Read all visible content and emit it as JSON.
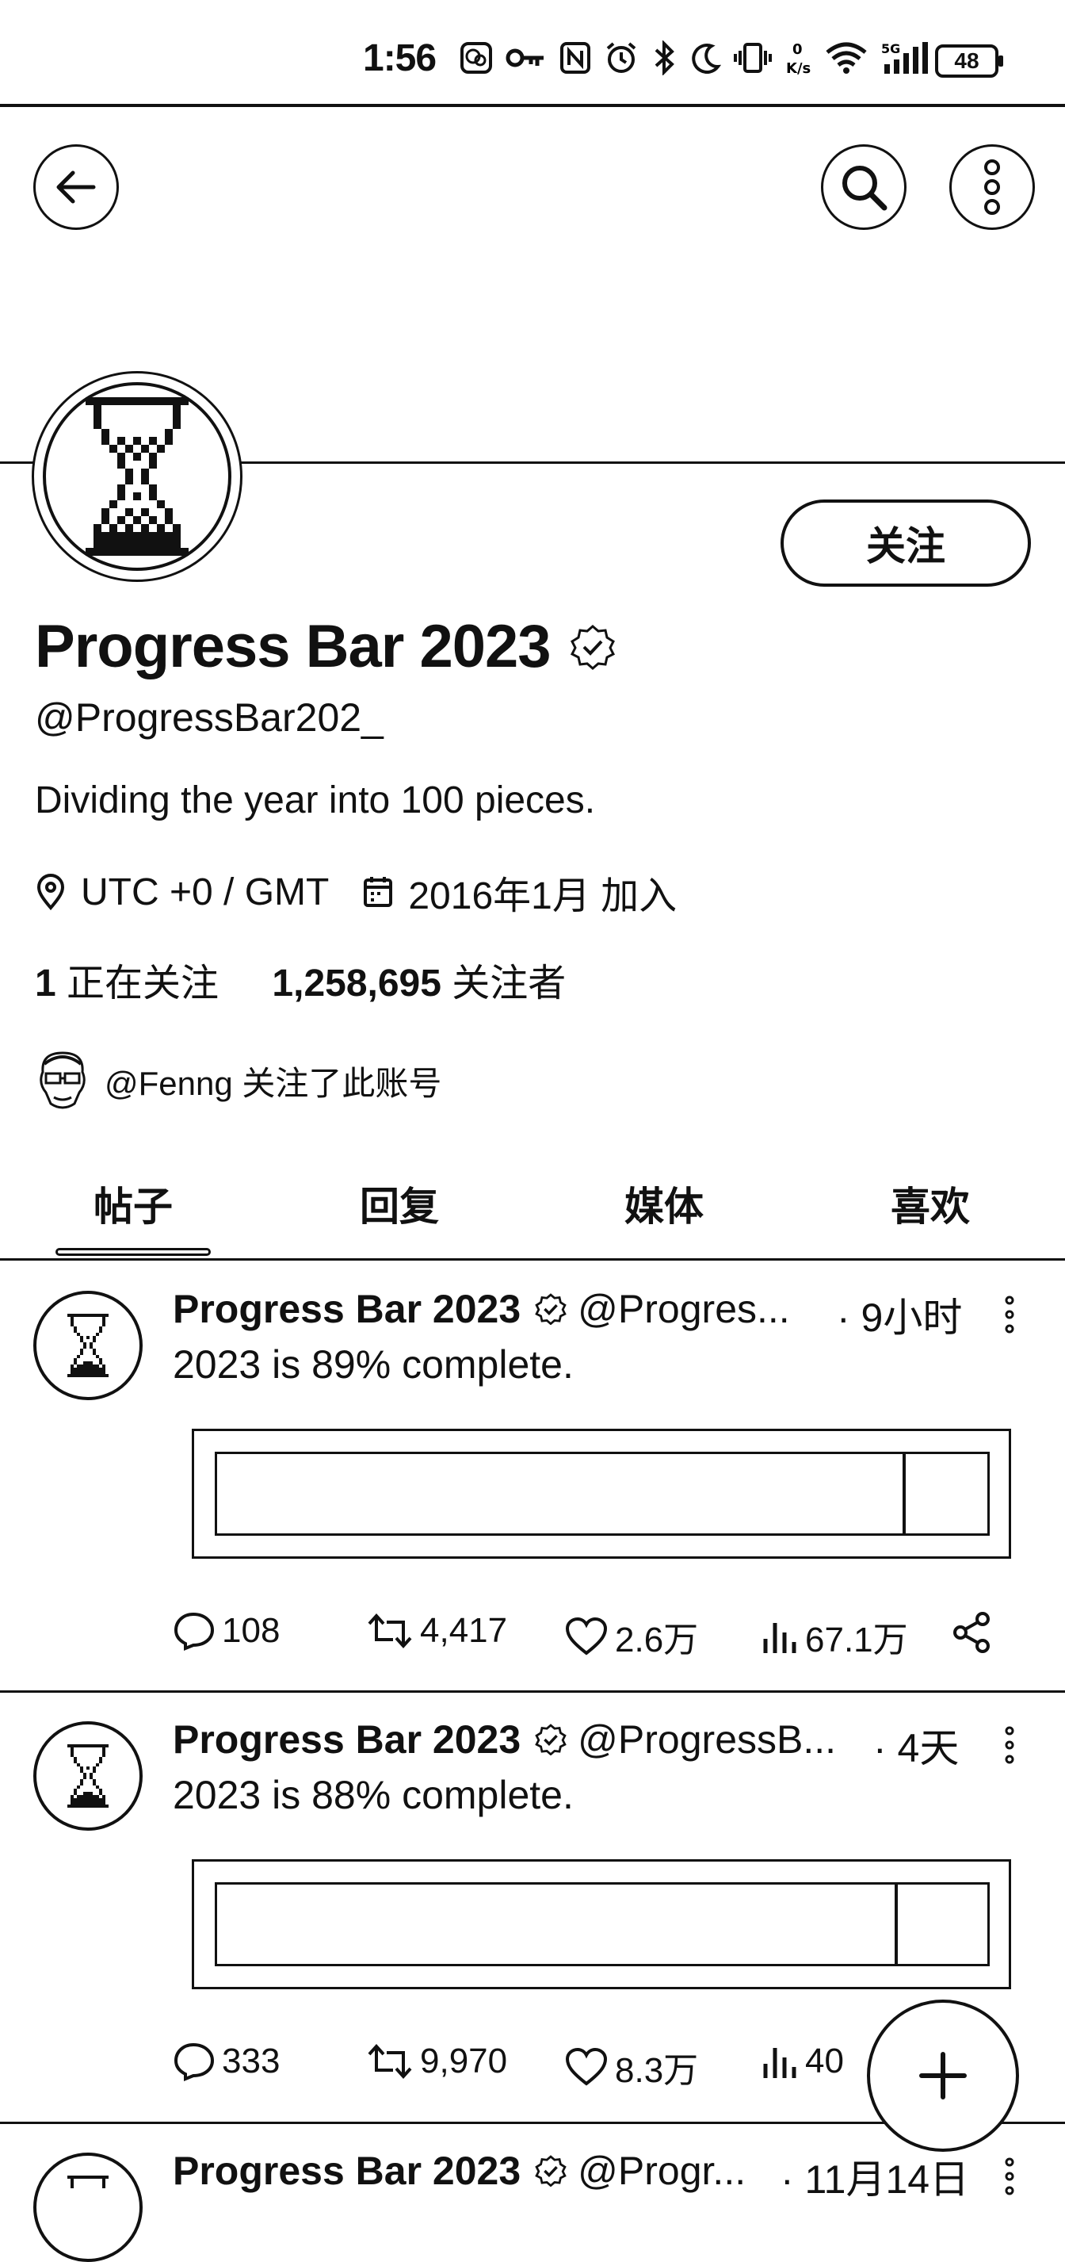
{
  "status_bar": {
    "time": "1:56",
    "battery": "48",
    "icons": [
      "wechat-icon",
      "key-icon",
      "nfc-icon",
      "alarm-icon",
      "bluetooth-icon",
      "moon-icon",
      "vibrate-icon",
      "data-speed-icon",
      "wifi-icon",
      "signal-5g-icon"
    ],
    "data_speed": "0 K/s",
    "network": "5G"
  },
  "profile": {
    "display_name": "Progress Bar 2023",
    "handle": "@ProgressBar202_",
    "bio": "Dividing the year into 100 pieces.",
    "location": "UTC +0 / GMT",
    "joined": "2016年1月 加入",
    "following_count": "1",
    "following_label": "正在关注",
    "followers_count": "1,258,695",
    "followers_label": "关注者",
    "followed_by": "@Fenng 关注了此账号",
    "follow_button": "关注",
    "verified": true
  },
  "tabs": [
    {
      "label": "帖子",
      "active": true
    },
    {
      "label": "回复",
      "active": false
    },
    {
      "label": "媒体",
      "active": false
    },
    {
      "label": "喜欢",
      "active": false
    }
  ],
  "tweets": [
    {
      "name": "Progress Bar 2023",
      "handle": "@Progres...",
      "time": "· 9小时",
      "text": "2023 is 89% complete.",
      "progress": 0.89,
      "replies": "108",
      "retweets": "4,417",
      "likes": "2.6万",
      "views": "67.1万"
    },
    {
      "name": "Progress Bar 2023",
      "handle": "@ProgressB...",
      "time": "· 4天",
      "text": "2023 is 88% complete.",
      "progress": 0.88,
      "replies": "333",
      "retweets": "9,970",
      "likes": "8.3万",
      "views": "40"
    },
    {
      "name": "Progress Bar 2023",
      "handle": "@Progr...",
      "time": "· 11月14日"
    }
  ],
  "colors": {
    "ink": "#111111",
    "background": "#ffffff"
  }
}
